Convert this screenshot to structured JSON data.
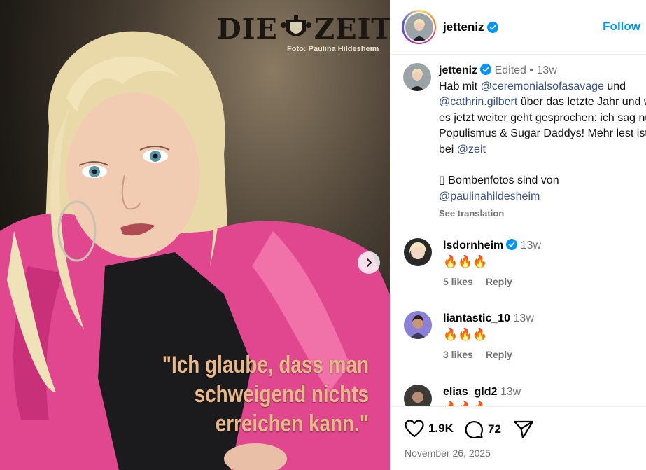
{
  "photo": {
    "masthead_left": "DIE",
    "masthead_right": "ZEIT",
    "credit": "Foto: Paulina Hildesheim",
    "quote_lines": [
      "\"Ich glaube, dass man",
      "schweigend nichts",
      "erreichen kann.\""
    ]
  },
  "header": {
    "username": "jetteniz",
    "follow_label": "Follow"
  },
  "caption": {
    "username": "jetteniz",
    "edited": "Edited",
    "separator": "•",
    "time": "13w",
    "t1": "Hab mit ",
    "mention1": "@ceremonialsofasavage",
    "t2": " und ",
    "mention2": "@cathrin.gilbert",
    "t3": " über das letzte Jahr und wie es jetzt weiter geht gesprochen: ich sag nur Populismus & Sugar Daddys! Mehr lest ist bei ",
    "mention3": "@zeit",
    "t4": "Bombenfotos sind von",
    "mention4": "@paulinahildesheim",
    "emoji_placeholder": "▯",
    "see_translation": "See translation"
  },
  "comments": [
    {
      "username": "lsdornheim",
      "verified": true,
      "time": "13w",
      "text": "🔥🔥🔥",
      "likes": "5 likes",
      "reply": "Reply"
    },
    {
      "username": "liantastic_10",
      "verified": false,
      "time": "13w",
      "text": "🔥🔥🔥",
      "likes": "3 likes",
      "reply": "Reply"
    },
    {
      "username": "elias_gld2",
      "verified": false,
      "time": "13w",
      "text": "🔥🔥🔥"
    }
  ],
  "actions": {
    "like_count": "1.9K",
    "comment_count": "72",
    "date": "November 26, 2025"
  },
  "colors": {
    "link": "#385185",
    "follow": "#0095f6",
    "verified": "#0095f6",
    "muted": "#737373",
    "quote": "#e8b986"
  },
  "icons": [
    "heart-icon",
    "comment-icon",
    "share-icon",
    "chevron-right-icon",
    "verified-badge-icon",
    "more-options-icon"
  ]
}
